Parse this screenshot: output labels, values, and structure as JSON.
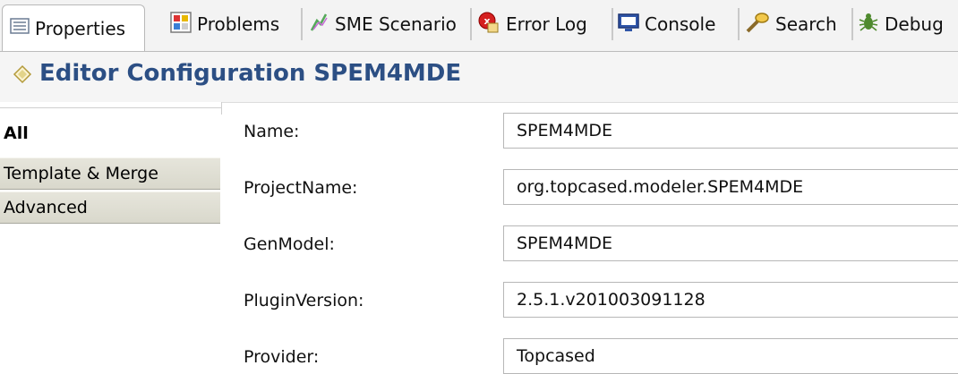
{
  "tabs": [
    {
      "label": "Properties",
      "icon": "properties-icon",
      "active": true
    },
    {
      "label": "Problems",
      "icon": "problems-icon",
      "active": false
    },
    {
      "label": "SME Scenario",
      "icon": "sme-scenario-icon",
      "active": false
    },
    {
      "label": "Error Log",
      "icon": "error-log-icon",
      "active": false
    },
    {
      "label": "Console",
      "icon": "console-icon",
      "active": false
    },
    {
      "label": "Search",
      "icon": "search-icon",
      "active": false
    },
    {
      "label": "Debug",
      "icon": "debug-icon",
      "active": false
    }
  ],
  "header": {
    "title": "Editor Configuration SPEM4MDE",
    "icon": "diamond-icon",
    "color": "#2c4f84"
  },
  "categories": [
    {
      "label": "All",
      "selected": true
    },
    {
      "label": "Template & Merge",
      "selected": false
    },
    {
      "label": "Advanced",
      "selected": false
    }
  ],
  "form": {
    "name": {
      "label": "Name:",
      "value": "SPEM4MDE"
    },
    "project_name": {
      "label": "ProjectName:",
      "value": "org.topcased.modeler.SPEM4MDE"
    },
    "gen_model": {
      "label": "GenModel:",
      "value": "SPEM4MDE"
    },
    "plugin_version": {
      "label": "PluginVersion:",
      "value": "2.5.1.v201003091128"
    },
    "provider": {
      "label": "Provider:",
      "value": "Topcased"
    }
  }
}
